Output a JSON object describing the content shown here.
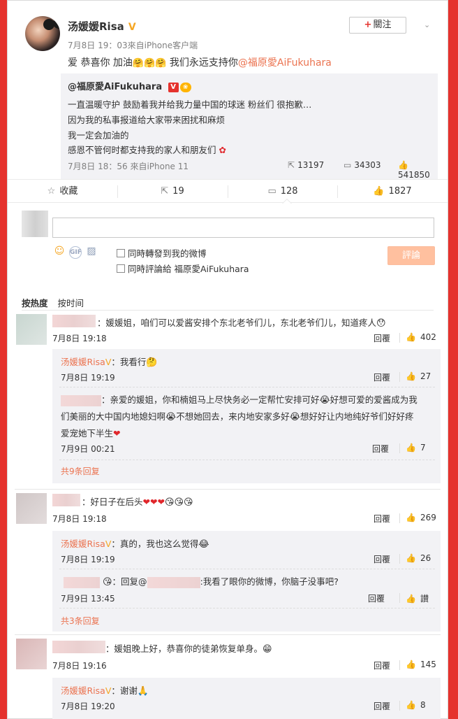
{
  "post": {
    "author": "汤媛媛Risa",
    "verified_badge": "V",
    "meta": "7月8日 19：03來自iPhone客户端",
    "follow_label": "關注",
    "follow_plus": "+",
    "text_prefix": "爱 恭喜你  加油",
    "emojis": "🤗🤗🤗",
    "text_suffix": "我们永远支持你",
    "mention": "@福原愛AiFukuhara"
  },
  "repost": {
    "author": "@福原愛AiFukuhara",
    "lines": [
      "一直温暖守护 鼓励着我并给我力量中国的球迷 粉丝们 很抱歉…",
      "因为我的私事报道给大家带来困扰和麻烦",
      "我一定会加油的",
      "感恩不管何时都支持我的家人和朋友们"
    ],
    "meta": "7月8日 18：56 來自iPhone 11",
    "reposts": "13197",
    "comments": "34303",
    "likes": "541850"
  },
  "actions": {
    "favorite": "收藏",
    "repost": "19",
    "comment": "128",
    "like": "1827"
  },
  "composer": {
    "check1": "同時轉發到我的微博",
    "check2": "同時評論給 福原愛AiFukuhara",
    "submit": "評論"
  },
  "sort": {
    "hot": "按热度",
    "time": "按时间"
  },
  "comments": [
    {
      "text": "：媛媛姐，咱们可以爱酱安排个东北老爷们儿，东北老爷们儿，知道疼人",
      "emoji": "😯",
      "time": "7月8日 19:18",
      "reply": "回覆",
      "likes": "402",
      "subs": [
        {
          "name": "汤媛媛Risa",
          "text": "：我看行",
          "emoji": "🤔",
          "time": "7月8日 19:19",
          "reply": "回覆",
          "likes": "27"
        },
        {
          "line1": "：亲爱的媛姐，你和楠姐马上尽快务必一定帮忙安排可好",
          "emoji1": "😭",
          "line1b": "好想可爱的爱酱成为我",
          "line2": "们美丽的大中国内地媳妇啊",
          "emoji2": "😭",
          "line2b": "不想她回去，来内地安家多好",
          "emoji3": "😭",
          "line2c": "想好好让内地纯好爷们好好疼",
          "line3": "爱宠她下半生",
          "time": "7月9日 00:21",
          "reply": "回覆",
          "likes": "7"
        }
      ],
      "more": "共9条回复"
    },
    {
      "text": "：好日子在后头",
      "hearts": "❤❤❤",
      "emoji": "😘😘😘",
      "time": "7月8日 19:18",
      "reply": "回覆",
      "likes": "269",
      "subs": [
        {
          "name": "汤媛媛Risa",
          "text": "：真的，我也这么觉得",
          "emoji": "😂",
          "time": "7月8日 19:19",
          "reply": "回覆",
          "likes": "26"
        },
        {
          "text1": "：回复@",
          "text2": ":我看了眼你的微博，你脑子没事吧?",
          "time": "7月9日 13:45",
          "reply": "回覆",
          "likes": "讃"
        }
      ],
      "more": "共3条回复"
    },
    {
      "text": "：媛姐晚上好，恭喜你的徒弟恢复单身。",
      "emoji": "😁",
      "time": "7月8日 19:16",
      "reply": "回覆",
      "likes": "145",
      "subs": [
        {
          "name": "汤媛媛Risa",
          "text": "：谢谢",
          "emoji": "🙏",
          "time": "7月8日 19:20",
          "reply": "回覆",
          "likes": "8"
        }
      ]
    }
  ]
}
